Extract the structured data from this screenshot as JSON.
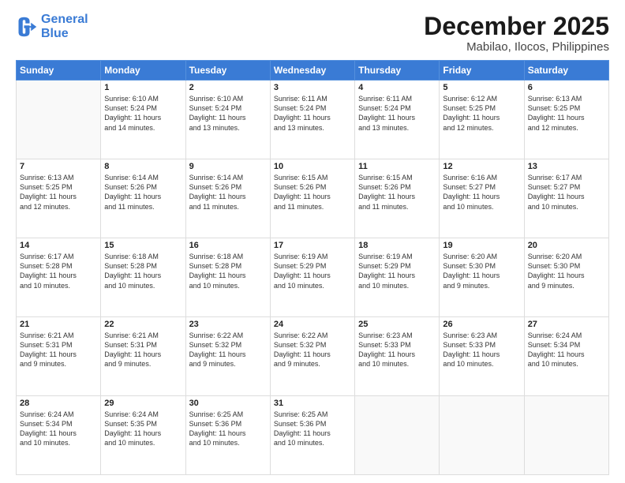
{
  "logo": {
    "line1": "General",
    "line2": "Blue"
  },
  "title": "December 2025",
  "subtitle": "Mabilao, Ilocos, Philippines",
  "days_of_week": [
    "Sunday",
    "Monday",
    "Tuesday",
    "Wednesday",
    "Thursday",
    "Friday",
    "Saturday"
  ],
  "weeks": [
    [
      {
        "day": "",
        "info": ""
      },
      {
        "day": "1",
        "info": "Sunrise: 6:10 AM\nSunset: 5:24 PM\nDaylight: 11 hours\nand 14 minutes."
      },
      {
        "day": "2",
        "info": "Sunrise: 6:10 AM\nSunset: 5:24 PM\nDaylight: 11 hours\nand 13 minutes."
      },
      {
        "day": "3",
        "info": "Sunrise: 6:11 AM\nSunset: 5:24 PM\nDaylight: 11 hours\nand 13 minutes."
      },
      {
        "day": "4",
        "info": "Sunrise: 6:11 AM\nSunset: 5:24 PM\nDaylight: 11 hours\nand 13 minutes."
      },
      {
        "day": "5",
        "info": "Sunrise: 6:12 AM\nSunset: 5:25 PM\nDaylight: 11 hours\nand 12 minutes."
      },
      {
        "day": "6",
        "info": "Sunrise: 6:13 AM\nSunset: 5:25 PM\nDaylight: 11 hours\nand 12 minutes."
      }
    ],
    [
      {
        "day": "7",
        "info": "Sunrise: 6:13 AM\nSunset: 5:25 PM\nDaylight: 11 hours\nand 12 minutes."
      },
      {
        "day": "8",
        "info": "Sunrise: 6:14 AM\nSunset: 5:26 PM\nDaylight: 11 hours\nand 11 minutes."
      },
      {
        "day": "9",
        "info": "Sunrise: 6:14 AM\nSunset: 5:26 PM\nDaylight: 11 hours\nand 11 minutes."
      },
      {
        "day": "10",
        "info": "Sunrise: 6:15 AM\nSunset: 5:26 PM\nDaylight: 11 hours\nand 11 minutes."
      },
      {
        "day": "11",
        "info": "Sunrise: 6:15 AM\nSunset: 5:26 PM\nDaylight: 11 hours\nand 11 minutes."
      },
      {
        "day": "12",
        "info": "Sunrise: 6:16 AM\nSunset: 5:27 PM\nDaylight: 11 hours\nand 10 minutes."
      },
      {
        "day": "13",
        "info": "Sunrise: 6:17 AM\nSunset: 5:27 PM\nDaylight: 11 hours\nand 10 minutes."
      }
    ],
    [
      {
        "day": "14",
        "info": "Sunrise: 6:17 AM\nSunset: 5:28 PM\nDaylight: 11 hours\nand 10 minutes."
      },
      {
        "day": "15",
        "info": "Sunrise: 6:18 AM\nSunset: 5:28 PM\nDaylight: 11 hours\nand 10 minutes."
      },
      {
        "day": "16",
        "info": "Sunrise: 6:18 AM\nSunset: 5:28 PM\nDaylight: 11 hours\nand 10 minutes."
      },
      {
        "day": "17",
        "info": "Sunrise: 6:19 AM\nSunset: 5:29 PM\nDaylight: 11 hours\nand 10 minutes."
      },
      {
        "day": "18",
        "info": "Sunrise: 6:19 AM\nSunset: 5:29 PM\nDaylight: 11 hours\nand 10 minutes."
      },
      {
        "day": "19",
        "info": "Sunrise: 6:20 AM\nSunset: 5:30 PM\nDaylight: 11 hours\nand 9 minutes."
      },
      {
        "day": "20",
        "info": "Sunrise: 6:20 AM\nSunset: 5:30 PM\nDaylight: 11 hours\nand 9 minutes."
      }
    ],
    [
      {
        "day": "21",
        "info": "Sunrise: 6:21 AM\nSunset: 5:31 PM\nDaylight: 11 hours\nand 9 minutes."
      },
      {
        "day": "22",
        "info": "Sunrise: 6:21 AM\nSunset: 5:31 PM\nDaylight: 11 hours\nand 9 minutes."
      },
      {
        "day": "23",
        "info": "Sunrise: 6:22 AM\nSunset: 5:32 PM\nDaylight: 11 hours\nand 9 minutes."
      },
      {
        "day": "24",
        "info": "Sunrise: 6:22 AM\nSunset: 5:32 PM\nDaylight: 11 hours\nand 9 minutes."
      },
      {
        "day": "25",
        "info": "Sunrise: 6:23 AM\nSunset: 5:33 PM\nDaylight: 11 hours\nand 10 minutes."
      },
      {
        "day": "26",
        "info": "Sunrise: 6:23 AM\nSunset: 5:33 PM\nDaylight: 11 hours\nand 10 minutes."
      },
      {
        "day": "27",
        "info": "Sunrise: 6:24 AM\nSunset: 5:34 PM\nDaylight: 11 hours\nand 10 minutes."
      }
    ],
    [
      {
        "day": "28",
        "info": "Sunrise: 6:24 AM\nSunset: 5:34 PM\nDaylight: 11 hours\nand 10 minutes."
      },
      {
        "day": "29",
        "info": "Sunrise: 6:24 AM\nSunset: 5:35 PM\nDaylight: 11 hours\nand 10 minutes."
      },
      {
        "day": "30",
        "info": "Sunrise: 6:25 AM\nSunset: 5:36 PM\nDaylight: 11 hours\nand 10 minutes."
      },
      {
        "day": "31",
        "info": "Sunrise: 6:25 AM\nSunset: 5:36 PM\nDaylight: 11 hours\nand 10 minutes."
      },
      {
        "day": "",
        "info": ""
      },
      {
        "day": "",
        "info": ""
      },
      {
        "day": "",
        "info": ""
      }
    ]
  ]
}
